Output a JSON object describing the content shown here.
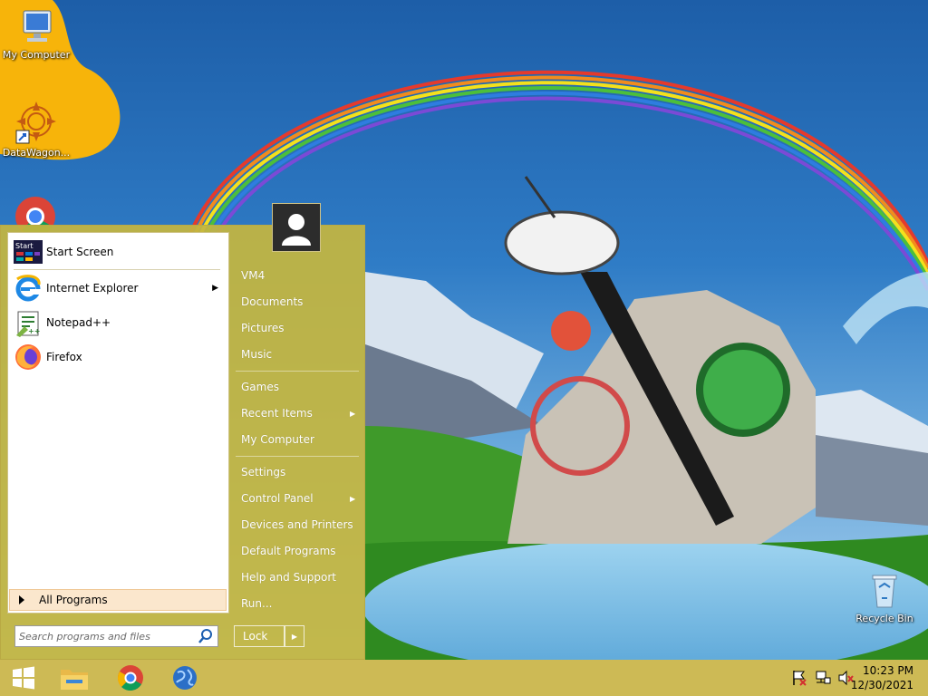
{
  "desktop": {
    "icons": [
      {
        "label": "My Computer",
        "icon": "monitor-icon"
      },
      {
        "label": "DataWagon...",
        "icon": "datawagon-icon"
      },
      {
        "label": "Recycle Bin",
        "icon": "recycle-bin-icon"
      }
    ]
  },
  "start_menu": {
    "pinned": [
      {
        "label": "Start Screen",
        "icon": "start-screen-icon"
      },
      {
        "label": "Internet Explorer",
        "icon": "internet-explorer-icon",
        "has_submenu": true
      },
      {
        "label": "Notepad++",
        "icon": "notepad-plus-plus-icon"
      },
      {
        "label": "Firefox",
        "icon": "firefox-icon"
      }
    ],
    "all_programs": "All Programs",
    "search_placeholder": "Search programs and files",
    "right_items": [
      {
        "label": "VM4"
      },
      {
        "label": "Documents"
      },
      {
        "label": "Pictures"
      },
      {
        "label": "Music"
      },
      {
        "label": "Games"
      },
      {
        "label": "Recent Items",
        "has_submenu": true
      },
      {
        "label": "My Computer"
      },
      {
        "label": "Settings"
      },
      {
        "label": "Control Panel",
        "has_submenu": true
      },
      {
        "label": "Devices and Printers"
      },
      {
        "label": "Default Programs"
      },
      {
        "label": "Help and Support"
      },
      {
        "label": "Run..."
      }
    ],
    "lock_label": "Lock"
  },
  "taskbar": {
    "pinned": [
      "windows-start-icon",
      "file-explorer-icon",
      "chrome-icon",
      "network-globe-icon"
    ],
    "tray": [
      "action-center-flag-icon",
      "network-icon",
      "volume-muted-icon"
    ],
    "time": "10:23 PM",
    "date": "12/30/2021"
  },
  "colors": {
    "menu_accent": "#c4b640",
    "taskbar": "#cbb850",
    "all_programs_highlight": "#fbe7cd"
  }
}
